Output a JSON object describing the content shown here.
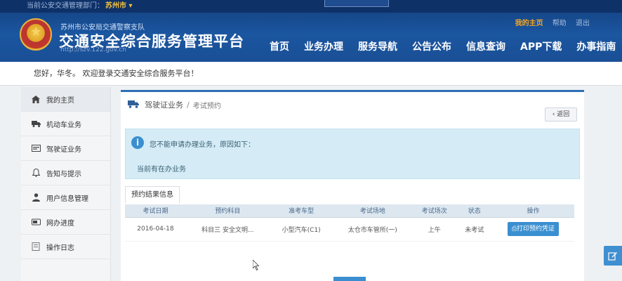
{
  "topbar": {
    "prefix": "当前公安交通管理部门：",
    "city": "苏州市 ▾"
  },
  "header": {
    "org": "苏州市公安局交通警察支队",
    "title": "交通安全综合服务管理平台",
    "url": "http://szv.122.gov.cn",
    "user_links": [
      "我的主页",
      "帮助",
      "退出"
    ]
  },
  "nav": [
    "首页",
    "业务办理",
    "服务导航",
    "公告公布",
    "信息查询",
    "APP下载",
    "办事指南"
  ],
  "welcome": "您好，华冬。 欢迎登录交通安全综合服务平台！",
  "sidebar": [
    {
      "label": "我的主页",
      "icon": "home-icon"
    },
    {
      "label": "机动车业务",
      "icon": "truck-icon"
    },
    {
      "label": "驾驶证业务",
      "icon": "card-icon"
    },
    {
      "label": "告知与提示",
      "icon": "bell-icon"
    },
    {
      "label": "用户信息管理",
      "icon": "user-icon"
    },
    {
      "label": "网办进度",
      "icon": "progress-icon"
    },
    {
      "label": "操作日志",
      "icon": "log-icon"
    }
  ],
  "breadcrumb": {
    "section": "驾驶证业务",
    "page": "考试预约"
  },
  "back_label": "‹ 返回",
  "alert": {
    "message": "您不能申请办理业务，原因如下：",
    "reason": "当前有在办业务"
  },
  "tab_label": "预约结果信息",
  "table": {
    "headers": [
      "考试日期",
      "预约科目",
      "准考车型",
      "考试场地",
      "考试场次",
      "状态",
      "操作"
    ],
    "rows": [
      [
        "2016-04-18",
        "科目三 安全文明...",
        "小型汽车(C1)",
        "太仓市车管所(一)",
        "上午",
        "未考试"
      ]
    ],
    "action_label": "⎙打印预约凭证"
  },
  "colors": {
    "header": "#1b56a0",
    "accent": "#2f6fb6",
    "alert_bg": "#d5ecf6",
    "button": "#3a8fd0"
  }
}
